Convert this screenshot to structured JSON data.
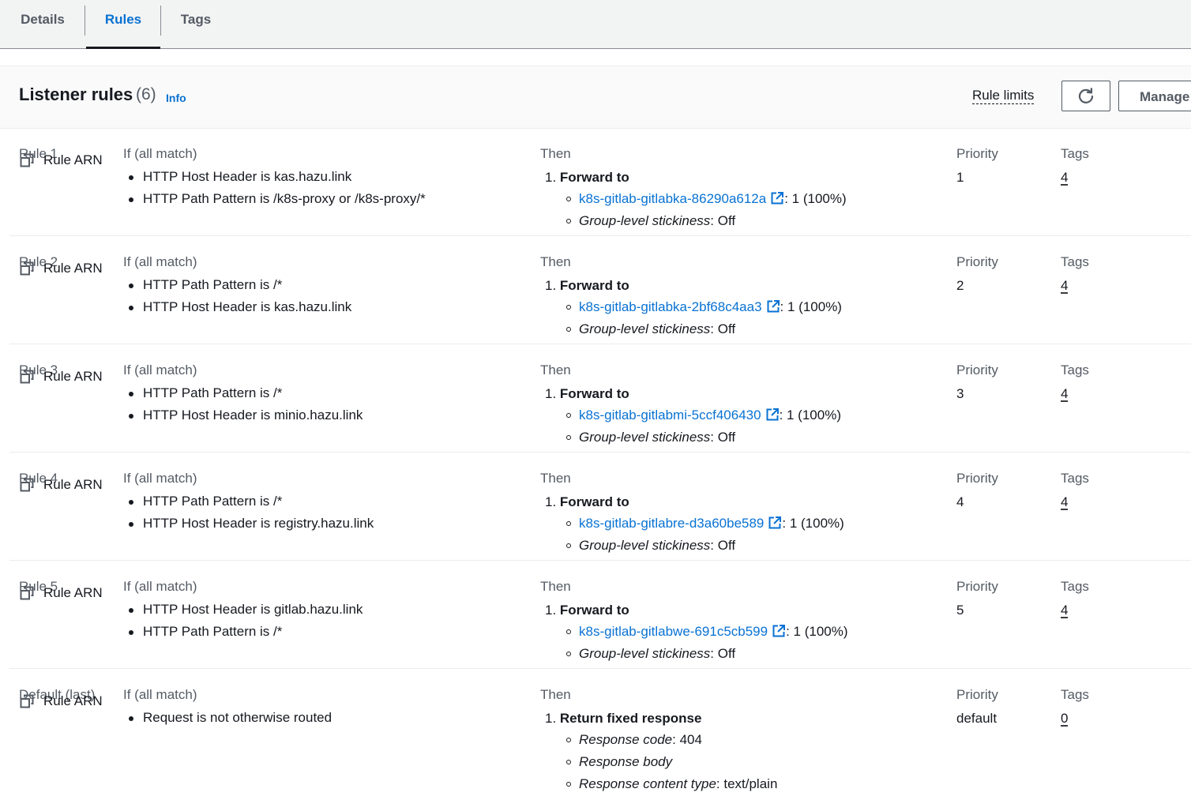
{
  "tabs": [
    {
      "label": "Details",
      "active": false
    },
    {
      "label": "Rules",
      "active": true
    },
    {
      "label": "Tags",
      "active": false
    }
  ],
  "header": {
    "title": "Listener rules",
    "count": "(6)",
    "info": "Info",
    "rule_limits": "Rule limits",
    "manage_label": "Manage rules"
  },
  "columns": {
    "if": "If (all match)",
    "then": "Then",
    "priority": "Priority",
    "tags": "Tags"
  },
  "rule_arn_label": "Rule ARN",
  "rules": [
    {
      "name": "Rule 1",
      "conditions": [
        "HTTP Host Header is kas.hazu.link",
        "HTTP Path Pattern is /k8s-proxy or /k8s-proxy/*"
      ],
      "action": "Forward to",
      "target_group": "k8s-gitlab-gitlabka-86290a612a",
      "weight": ": 1 (100%)",
      "stickiness_label": "Group-level stickiness",
      "stickiness_value": ": Off",
      "priority": "1",
      "tags": "4"
    },
    {
      "name": "Rule 2",
      "conditions": [
        "HTTP Path Pattern is /*",
        "HTTP Host Header is kas.hazu.link"
      ],
      "action": "Forward to",
      "target_group": "k8s-gitlab-gitlabka-2bf68c4aa3",
      "weight": ": 1 (100%)",
      "stickiness_label": "Group-level stickiness",
      "stickiness_value": ": Off",
      "priority": "2",
      "tags": "4"
    },
    {
      "name": "Rule 3",
      "conditions": [
        "HTTP Path Pattern is /*",
        "HTTP Host Header is minio.hazu.link"
      ],
      "action": "Forward to",
      "target_group": "k8s-gitlab-gitlabmi-5ccf406430",
      "weight": ": 1 (100%)",
      "stickiness_label": "Group-level stickiness",
      "stickiness_value": ": Off",
      "priority": "3",
      "tags": "4"
    },
    {
      "name": "Rule 4",
      "conditions": [
        "HTTP Path Pattern is /*",
        "HTTP Host Header is registry.hazu.link"
      ],
      "action": "Forward to",
      "target_group": "k8s-gitlab-gitlabre-d3a60be589",
      "weight": ": 1 (100%)",
      "stickiness_label": "Group-level stickiness",
      "stickiness_value": ": Off",
      "priority": "4",
      "tags": "4"
    },
    {
      "name": "Rule 5",
      "conditions": [
        "HTTP Host Header is gitlab.hazu.link",
        "HTTP Path Pattern is /*"
      ],
      "action": "Forward to",
      "target_group": "k8s-gitlab-gitlabwe-691c5cb599",
      "weight": ": 1 (100%)",
      "stickiness_label": "Group-level stickiness",
      "stickiness_value": ": Off",
      "priority": "5",
      "tags": "4"
    }
  ],
  "default_rule": {
    "name": "Default (last)",
    "conditions": [
      "Request is not otherwise routed"
    ],
    "action": "Return fixed response",
    "details": [
      {
        "label": "Response code",
        "value": ": 404"
      },
      {
        "label": "Response body",
        "value": ""
      },
      {
        "label": "Response content type",
        "value": ": text/plain"
      }
    ],
    "priority": "default",
    "tags": "0"
  }
}
